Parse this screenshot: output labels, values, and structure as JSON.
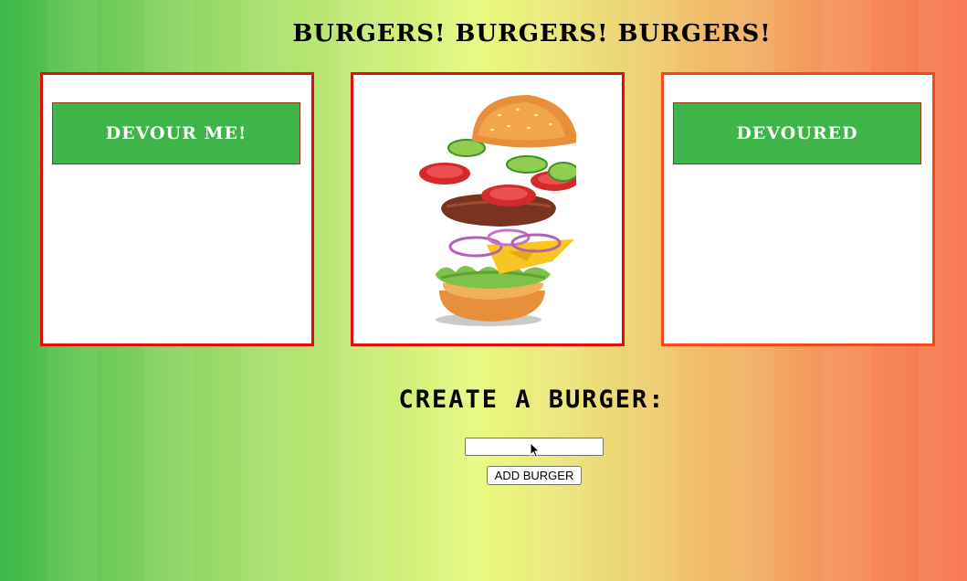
{
  "header": {
    "title": "BURGERS!  BURGERS!  BURGERS!"
  },
  "panels": {
    "left": {
      "button_label": "DEVOUR ME!"
    },
    "center": {
      "image_icon": "burger-illustration"
    },
    "right": {
      "button_label": "DEVOURED"
    }
  },
  "create": {
    "title": "CREATE A BURGER:",
    "input_value": "",
    "input_placeholder": "",
    "submit_label": "ADD BURGER"
  },
  "colors": {
    "gradient_start": "#3bb84a",
    "gradient_mid": "#e9f97f",
    "gradient_end": "#f8734f",
    "panel_border": "#e30d0d",
    "panel_border_right": "#f54a12",
    "button_green": "#3db548"
  }
}
